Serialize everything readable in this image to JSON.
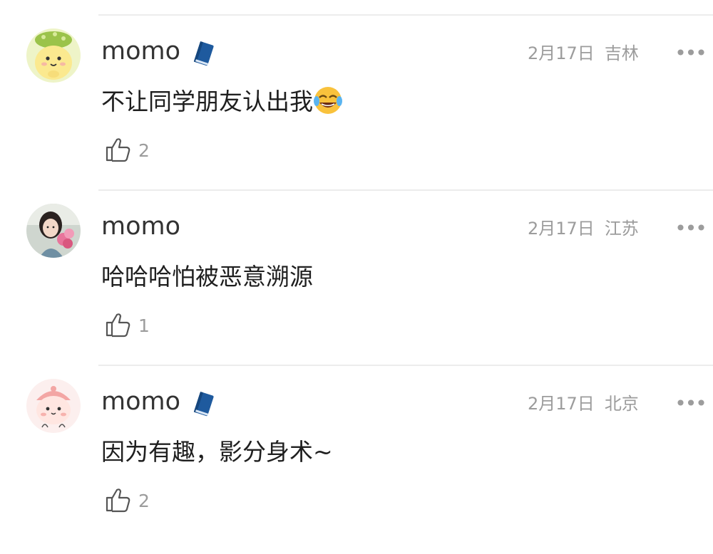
{
  "comments": [
    {
      "username": "momo",
      "has_badge": true,
      "date": "2月17日",
      "location": "吉林",
      "text": "不让同学朋友认出我",
      "emoji": "joy-emoji",
      "likes": "2",
      "avatar": "yellow-cartoon-avatar"
    },
    {
      "username": "momo",
      "has_badge": false,
      "date": "2月17日",
      "location": "江苏",
      "text": "哈哈哈怕被恶意溯源",
      "likes": "1",
      "avatar": "photo-avatar"
    },
    {
      "username": "momo",
      "has_badge": true,
      "date": "2月17日",
      "location": "北京",
      "text": "因为有趣，影分身术~",
      "likes": "2",
      "avatar": "pink-cartoon-avatar"
    }
  ],
  "more_icon": "more-dots-icon",
  "like_icon": "thumbs-up-icon",
  "badge_icon": "blue-book-icon",
  "colors": {
    "text": "#1f1f1f",
    "meta": "#9c9c9c",
    "divider": "#ececec",
    "badge": "#1e5a9e"
  }
}
